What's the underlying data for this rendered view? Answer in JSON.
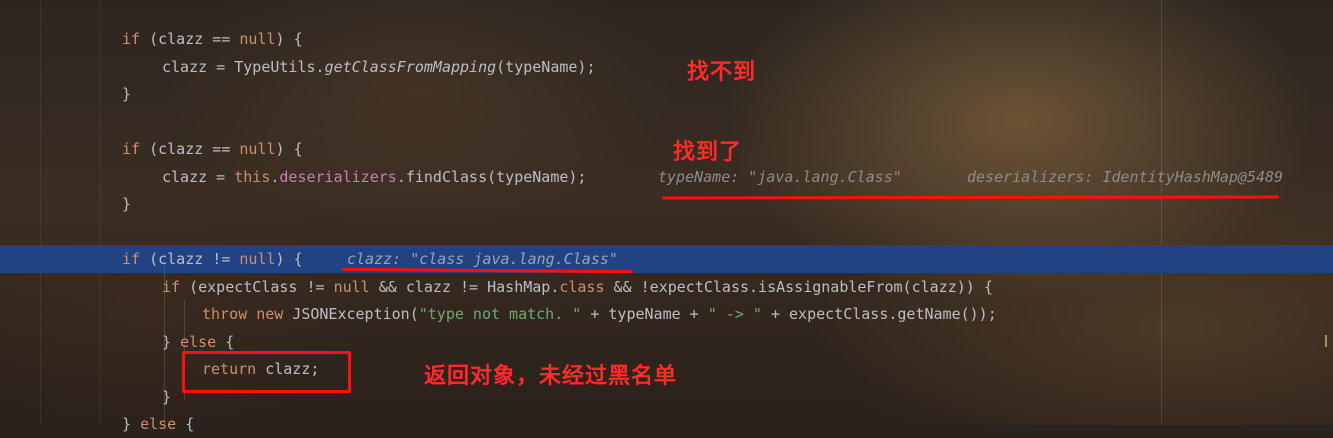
{
  "code_lines": {
    "l1": {
      "kw_if": "if",
      "a": " (clazz == ",
      "kw_null": "null",
      "b": ") {"
    },
    "l2": {
      "a": "clazz = TypeUtils.",
      "method": "getClassFromMapping",
      "b": "(typeName);"
    },
    "l3": {
      "a": "}"
    },
    "l4": {
      "kw_if": "if",
      "a": " (clazz == ",
      "kw_null": "null",
      "b": ") {"
    },
    "l5": {
      "a": "clazz = ",
      "kw_this": "this",
      "dot": ".",
      "field": "deserializers",
      "b": ".findClass(typeName);"
    },
    "l6": {
      "a": "}"
    },
    "l7": {
      "kw_if": "if",
      "a": " (clazz != ",
      "kw_null": "null",
      "b": ") {"
    },
    "l8": {
      "kw_if": "if",
      "a": " (expectClass != ",
      "kw_null": "null",
      "b": " && clazz != HashMap.",
      "kw_class": "class",
      "c": " && !expectClass.isAssignableFrom(clazz)) {"
    },
    "l9": {
      "kw_throw": "throw",
      "sp": " ",
      "kw_new": "new",
      "a": " JSONException(",
      "str1": "\"type not match. \"",
      "b": " + typeName + ",
      "str2": "\" -> \"",
      "c": " + expectClass.getName());"
    },
    "l10": {
      "a": "} ",
      "kw_else": "else",
      "b": " {"
    },
    "l11": {
      "kw_return": "return",
      "a": " clazz;"
    },
    "l12": {
      "a": "}"
    },
    "l13": {
      "a": "} ",
      "kw_else": "else",
      "b": " {"
    }
  },
  "debug_hints": {
    "type_name": "typeName: \"java.lang.Class\"",
    "deserializers": "deserializers: IdentityHashMap@5489",
    "clazz": "clazz: \"class java.lang.Class\""
  },
  "annotations": {
    "not_found": "找不到",
    "found": "找到了",
    "returned": "返回对象，未经过黑名单"
  },
  "colors": {
    "keyword": "#cf8e6d",
    "field": "#c77dbb",
    "string": "#6aab73",
    "text": "#bcbec4",
    "hint": "#8c8c8c",
    "current_line": "#214283",
    "annotation": "#ff2a2a"
  }
}
